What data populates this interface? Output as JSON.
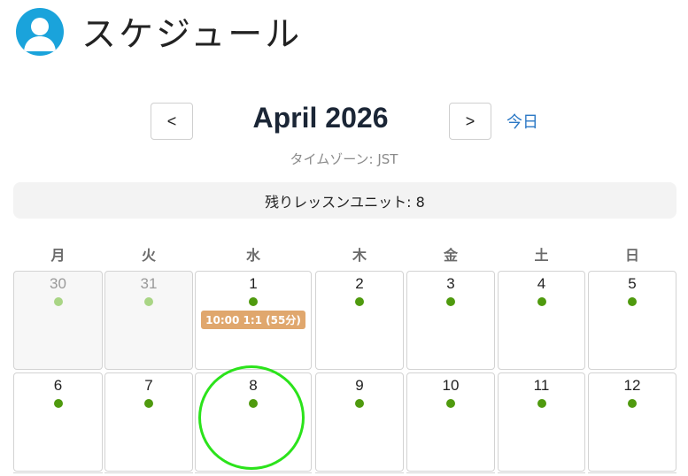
{
  "header": {
    "title": "スケジュール",
    "avatar_icon": "user-avatar-icon"
  },
  "nav": {
    "prev_label": "<",
    "next_label": ">",
    "month_title": "April 2026",
    "today_label": "今日"
  },
  "timezone": "タイムゾーン: JST",
  "units": {
    "label": "残りレッスンユニット: 8"
  },
  "weekdays": [
    "月",
    "火",
    "水",
    "木",
    "金",
    "土",
    "日"
  ],
  "weeks": [
    [
      {
        "day": "30",
        "muted": true
      },
      {
        "day": "31",
        "muted": true
      },
      {
        "day": "1",
        "muted": false,
        "lesson": "10:00 1:1 (55分)"
      },
      {
        "day": "2",
        "muted": false
      },
      {
        "day": "3",
        "muted": false
      },
      {
        "day": "4",
        "muted": false
      },
      {
        "day": "5",
        "muted": false
      }
    ],
    [
      {
        "day": "6",
        "muted": false
      },
      {
        "day": "7",
        "muted": false
      },
      {
        "day": "8",
        "muted": false,
        "highlighted": true
      },
      {
        "day": "9",
        "muted": false
      },
      {
        "day": "10",
        "muted": false
      },
      {
        "day": "11",
        "muted": false
      },
      {
        "day": "12",
        "muted": false
      }
    ]
  ],
  "colors": {
    "accent": "#1aa3db",
    "available_dot": "#4f9a0e",
    "past_dot": "#a9d585",
    "lesson_badge": "#e0a76d",
    "highlight": "#2be31b",
    "link": "#2b78c5"
  }
}
